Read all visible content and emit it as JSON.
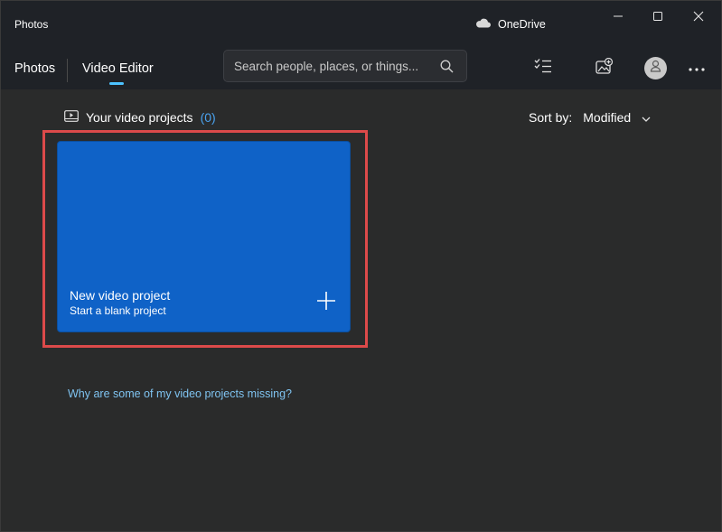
{
  "titlebar": {
    "app_title": "Photos",
    "onedrive_label": "OneDrive",
    "icons": [
      "cloud-icon",
      "minimize-icon",
      "maximize-icon",
      "close-icon"
    ]
  },
  "nav": {
    "tabs": [
      {
        "label": "Photos",
        "selected": false
      },
      {
        "label": "Video Editor",
        "selected": true
      }
    ],
    "search_placeholder": "Search people, places, or things...",
    "toolbar_icons": [
      "select-checklist-icon",
      "import-icon",
      "account-icon",
      "more-icon"
    ]
  },
  "main": {
    "projects_title": "Your video projects",
    "projects_count": "(0)",
    "sort_label": "Sort by:",
    "sort_value": "Modified",
    "new_project": {
      "title": "New video project",
      "subtitle": "Start a blank project"
    },
    "help_link": "Why are some of my video projects missing?"
  },
  "colors": {
    "accent": "#4cc2ff",
    "tile": "#0f62c7",
    "highlight": "#dc4a4a",
    "link": "#7fc3f0"
  }
}
